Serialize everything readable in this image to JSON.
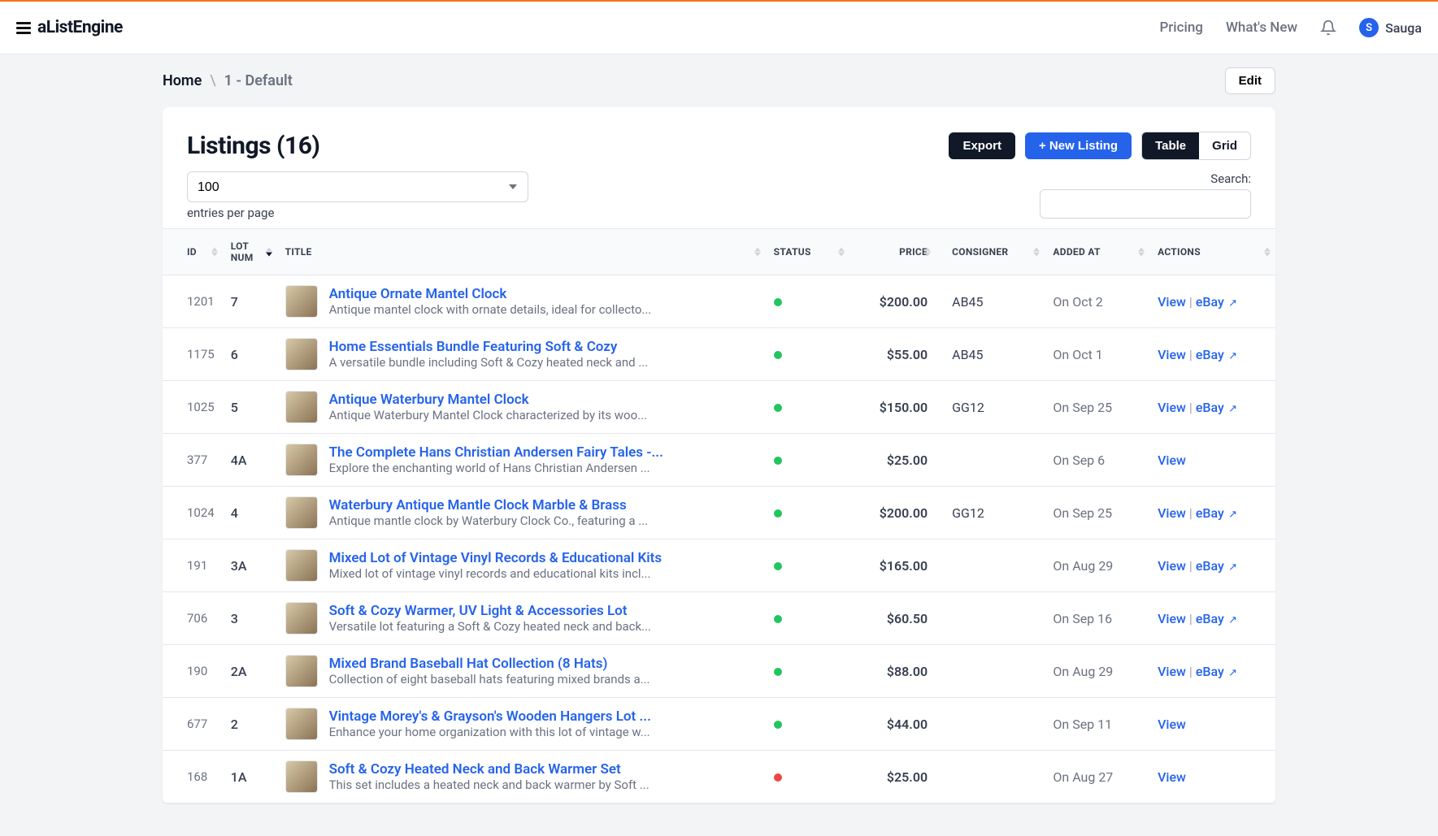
{
  "brand": "aListEngine",
  "topnav": {
    "pricing": "Pricing",
    "whatsnew": "What's New"
  },
  "user": {
    "initial": "S",
    "name": "Sauga"
  },
  "breadcrumb": {
    "home": "Home",
    "sep": "\\",
    "current": "1 - Default"
  },
  "edit_btn": "Edit",
  "page_title": "Listings (16)",
  "buttons": {
    "export": "Export",
    "new_listing": "+ New Listing",
    "table": "Table",
    "grid": "Grid"
  },
  "entries": {
    "value": "100",
    "label": "entries per page"
  },
  "search": {
    "label": "Search:"
  },
  "columns": {
    "id": "ID",
    "lot": "LOT NUM",
    "title": "TITLE",
    "status": "STATUS",
    "price": "PRICE",
    "consigner": "CONSIGNER",
    "added": "ADDED AT",
    "actions": "ACTIONS"
  },
  "action_labels": {
    "view": "View",
    "ebay": "eBay"
  },
  "rows": [
    {
      "id": "1201",
      "lot": "7",
      "title": "Antique Ornate Mantel Clock",
      "desc": "Antique mantel clock with ornate details, ideal for collecto...",
      "status": "green",
      "price": "$200.00",
      "consigner": "AB45",
      "added": "On Oct 2",
      "ebay": true
    },
    {
      "id": "1175",
      "lot": "6",
      "title": "Home Essentials Bundle Featuring Soft & Cozy",
      "desc": "A versatile bundle including Soft & Cozy heated neck and ...",
      "status": "green",
      "price": "$55.00",
      "consigner": "AB45",
      "added": "On Oct 1",
      "ebay": true
    },
    {
      "id": "1025",
      "lot": "5",
      "title": "Antique Waterbury Mantel Clock",
      "desc": "Antique Waterbury Mantel Clock characterized by its woo...",
      "status": "green",
      "price": "$150.00",
      "consigner": "GG12",
      "added": "On Sep 25",
      "ebay": true
    },
    {
      "id": "377",
      "lot": "4A",
      "title": "The Complete Hans Christian Andersen Fairy Tales -...",
      "desc": "Explore the enchanting world of Hans Christian Andersen ...",
      "status": "green",
      "price": "$25.00",
      "consigner": "",
      "added": "On Sep 6",
      "ebay": false
    },
    {
      "id": "1024",
      "lot": "4",
      "title": "Waterbury Antique Mantle Clock Marble & Brass",
      "desc": "Antique mantle clock by Waterbury Clock Co., featuring a ...",
      "status": "green",
      "price": "$200.00",
      "consigner": "GG12",
      "added": "On Sep 25",
      "ebay": true
    },
    {
      "id": "191",
      "lot": "3A",
      "title": "Mixed Lot of Vintage Vinyl Records & Educational Kits",
      "desc": "Mixed lot of vintage vinyl records and educational kits incl...",
      "status": "green",
      "price": "$165.00",
      "consigner": "",
      "added": "On Aug 29",
      "ebay": true
    },
    {
      "id": "706",
      "lot": "3",
      "title": "Soft & Cozy Warmer, UV Light & Accessories Lot",
      "desc": "Versatile lot featuring a Soft & Cozy heated neck and back...",
      "status": "green",
      "price": "$60.50",
      "consigner": "",
      "added": "On Sep 16",
      "ebay": true
    },
    {
      "id": "190",
      "lot": "2A",
      "title": "Mixed Brand Baseball Hat Collection (8 Hats)",
      "desc": "Collection of eight baseball hats featuring mixed brands a...",
      "status": "green",
      "price": "$88.00",
      "consigner": "",
      "added": "On Aug 29",
      "ebay": true
    },
    {
      "id": "677",
      "lot": "2",
      "title": "Vintage Morey's & Grayson's Wooden Hangers Lot ...",
      "desc": "Enhance your home organization with this lot of vintage w...",
      "status": "green",
      "price": "$44.00",
      "consigner": "",
      "added": "On Sep 11",
      "ebay": false
    },
    {
      "id": "168",
      "lot": "1A",
      "title": "Soft & Cozy Heated Neck and Back Warmer Set",
      "desc": "This set includes a heated neck and back warmer by Soft ...",
      "status": "red",
      "price": "$25.00",
      "consigner": "",
      "added": "On Aug 27",
      "ebay": false
    }
  ]
}
